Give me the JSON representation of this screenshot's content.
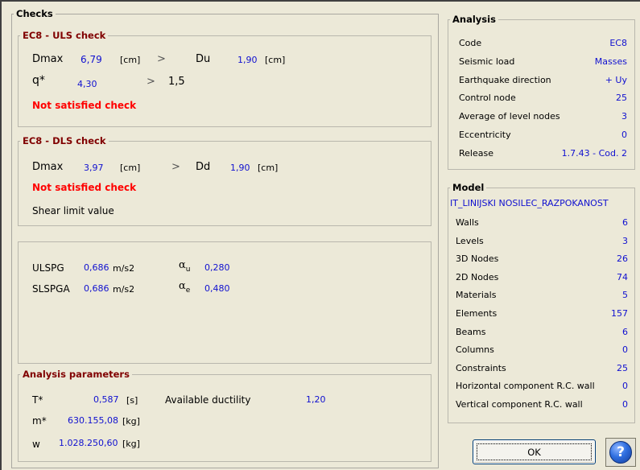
{
  "checks": {
    "title": "Checks",
    "uls": {
      "title": "EC8 - ULS check",
      "dmax_label": "Dmax",
      "dmax_value": "6,79",
      "dmax_unit": "[cm]",
      "op1": ">",
      "du_label": "Du",
      "du_value": "1,90",
      "du_unit": "[cm]",
      "q_label": "q*",
      "q_value": "4,30",
      "op2": ">",
      "q_limit": "1,5",
      "status": "Not satisfied check"
    },
    "dls": {
      "title": "EC8 - DLS check",
      "dmax_label": "Dmax",
      "dmax_value": "3,97",
      "dmax_unit": "[cm]",
      "op": ">",
      "dd_label": "Dd",
      "dd_value": "1,90",
      "dd_unit": "[cm]",
      "status": "Not satisfied check",
      "note": "Shear limit value"
    },
    "pga": {
      "ulspg_label": "ULSPG",
      "ulspg_value": "0,686",
      "ulspg_unit": "m/s2",
      "alpha_u_symbol": "α",
      "alpha_u_sub": "u",
      "alpha_u_value": "0,280",
      "slspga_label": "SLSPGA",
      "slspga_value": "0,686",
      "slspga_unit": "m/s2",
      "alpha_e_symbol": "α",
      "alpha_e_sub": "e",
      "alpha_e_value": "0,480"
    },
    "params": {
      "title": "Analysis parameters",
      "t_label": "T*",
      "t_value": "0,587",
      "t_unit": "[s]",
      "ductility_label": "Available ductility",
      "ductility_value": "1,20",
      "m_label": "m*",
      "m_value": "630.155,08",
      "m_unit": "[kg]",
      "w_label": "w",
      "w_value": "1.028.250,60",
      "w_unit": "[kg]"
    }
  },
  "analysis": {
    "title": "Analysis",
    "rows": [
      {
        "label": "Code",
        "value": "EC8"
      },
      {
        "label": "Seismic load",
        "value": "Masses"
      },
      {
        "label": "Earthquake direction",
        "value": "+ Uy"
      },
      {
        "label": "Control node",
        "value": "25"
      },
      {
        "label": "Average of level nodes",
        "value": "3"
      },
      {
        "label": "Eccentricity",
        "value": "0"
      },
      {
        "label": "Release",
        "value": "1.7.43 - Cod. 2"
      }
    ]
  },
  "model": {
    "title": "Model",
    "name": "IT_LINIJSKI NOSILEC_RAZPOKANOST",
    "rows": [
      {
        "label": "Walls",
        "value": "6"
      },
      {
        "label": "Levels",
        "value": "3"
      },
      {
        "label": "3D Nodes",
        "value": "26"
      },
      {
        "label": "2D Nodes",
        "value": "74"
      },
      {
        "label": "Materials",
        "value": "5"
      },
      {
        "label": "Elements",
        "value": "157"
      },
      {
        "label": "Beams",
        "value": "6"
      },
      {
        "label": "Columns",
        "value": "0"
      },
      {
        "label": "Constraints",
        "value": "25"
      },
      {
        "label": "Horizontal component R.C. wall",
        "value": "0"
      },
      {
        "label": "Vertical component R.C. wall",
        "value": "0"
      }
    ]
  },
  "buttons": {
    "ok_label": "OK",
    "help_label": "?"
  },
  "colors": {
    "background": "#ece9d8",
    "value_blue": "#1010d0",
    "error_red": "#ff0000",
    "group_title_red": "#800000"
  }
}
